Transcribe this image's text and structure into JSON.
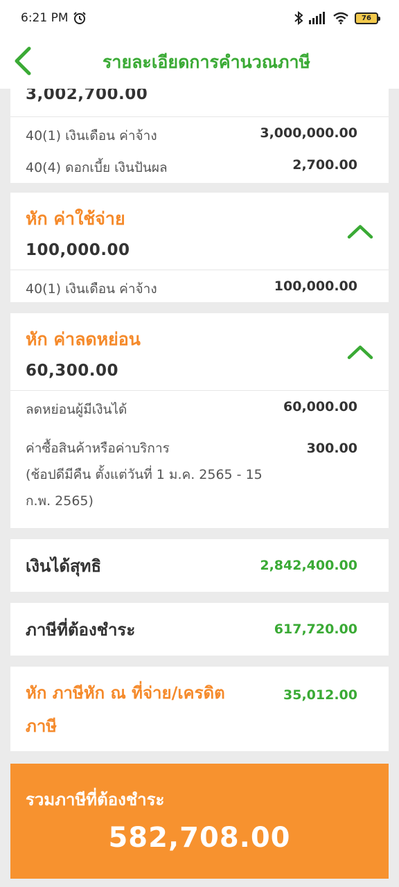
{
  "status_bar": {
    "time": "6:21 PM",
    "battery": "76"
  },
  "header": {
    "title": "รายละเอียดการคำนวณภาษี"
  },
  "income": {
    "total": "3,002,700.00",
    "items": [
      {
        "label": "40(1) เงินเดือน ค่าจ้าง",
        "amount": "3,000,000.00"
      },
      {
        "label": "40(4) ดอกเบี้ย เงินปันผล",
        "amount": "2,700.00"
      }
    ]
  },
  "expense": {
    "title": "หัก ค่าใช้จ่าย",
    "total": "100,000.00",
    "items": [
      {
        "label": "40(1) เงินเดือน ค่าจ้าง",
        "amount": "100,000.00"
      }
    ]
  },
  "allowance": {
    "title": "หัก ค่าลดหย่อน",
    "total": "60,300.00",
    "items": [
      {
        "label": "ลดหย่อนผู้มีเงินได้",
        "amount": "60,000.00"
      },
      {
        "label_line1": "ค่าซื้อสินค้าหรือค่าบริการ",
        "label_line2": "(ช้อปดีมีคืน ตั้งแต่วันที่ 1 ม.ค. 2565 - 15",
        "label_line3": "ก.พ. 2565)",
        "amount": "300.00"
      }
    ]
  },
  "net_income": {
    "label": "เงินได้สุทธิ",
    "amount": "2,842,400.00"
  },
  "tax_due": {
    "label": "ภาษีที่ต้องชำระ",
    "amount": "617,720.00"
  },
  "withholding": {
    "label_line1": "หัก ภาษีหัก ณ ที่จ่าย/เครดิต",
    "label_line2": "ภาษี",
    "amount": "35,012.00"
  },
  "total_tax": {
    "label": "รวมภาษีที่ต้องชำระ",
    "amount": "582,708.00"
  },
  "colors": {
    "green": "#3aaa35",
    "orange": "#f58a2b",
    "total_bg": "#f7922f"
  }
}
